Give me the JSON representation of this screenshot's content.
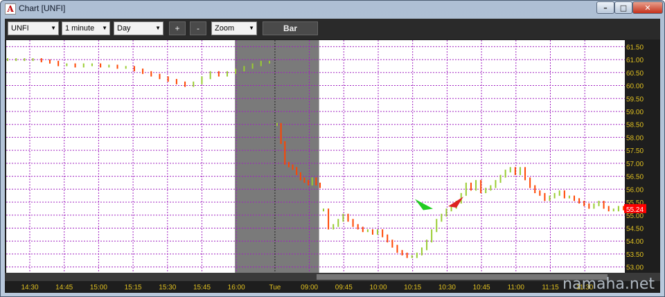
{
  "window": {
    "title": "Chart [UNFI]",
    "app_icon_letter": "A",
    "min_glyph": "–",
    "max_glyph": "□",
    "close_glyph": "✕"
  },
  "toolbar": {
    "symbol": "UNFI",
    "interval": "1 minute",
    "period": "Day",
    "zoom_in_label": "+",
    "zoom_out_label": "-",
    "zoom": "Zoom",
    "style_button": "Bar"
  },
  "watermark": "namaha.net",
  "chart_data": {
    "type": "bar",
    "price_axis": {
      "ticks": [
        "61.50",
        "61.00",
        "60.50",
        "60.00",
        "59.50",
        "59.00",
        "58.50",
        "58.00",
        "57.50",
        "57.00",
        "56.50",
        "56.00",
        "55.50",
        "55.00",
        "54.50",
        "54.00",
        "53.50",
        "53.00"
      ],
      "ylim": [
        52.75,
        61.75
      ]
    },
    "time_axis": {
      "ticks": [
        "14:30",
        "14:45",
        "15:00",
        "15:15",
        "15:30",
        "15:45",
        "16:00",
        "Tue",
        "09:00",
        "09:45",
        "10:00",
        "10:15",
        "10:30",
        "10:45",
        "11:00",
        "11:15",
        "11:30"
      ],
      "shaded_session": [
        "16:00",
        "09:00"
      ]
    },
    "last_price": "55.24",
    "series": [
      {
        "segment": "prev-day-afternoon",
        "values": [
          61.0,
          61.0,
          61.0,
          61.0,
          60.95,
          60.9,
          60.8,
          60.8,
          60.75,
          60.8,
          60.8,
          60.75,
          60.75,
          60.7,
          60.7,
          60.6,
          60.5,
          60.4,
          60.3,
          60.2,
          60.1,
          60.0,
          60.1,
          60.3,
          60.5,
          60.4,
          60.5,
          60.6,
          60.7,
          60.8,
          60.9,
          60.9
        ]
      },
      {
        "segment": "pre-market",
        "values": [
          58.5,
          57.8,
          57.0,
          56.9,
          56.8,
          56.6,
          56.4,
          56.3,
          56.2,
          56.4,
          56.2,
          56.1
        ]
      },
      {
        "segment": "regular-session",
        "values": [
          55.2,
          54.5,
          54.6,
          54.8,
          55.0,
          54.8,
          54.6,
          54.5,
          54.4,
          54.4,
          54.3,
          54.4,
          54.2,
          54.0,
          53.8,
          53.6,
          53.5,
          53.4,
          53.4,
          53.5,
          53.7,
          54.0,
          54.4,
          54.8,
          55.0,
          55.2,
          55.3,
          55.5,
          55.8,
          56.2,
          56.0,
          56.3,
          55.9,
          56.0,
          56.1,
          56.3,
          56.5,
          56.7,
          56.8,
          56.6,
          56.8,
          56.4,
          56.1,
          55.9,
          55.8,
          55.6,
          55.7,
          55.8,
          55.9,
          55.7,
          55.7,
          55.6,
          55.5,
          55.4,
          55.3,
          55.4,
          55.5,
          55.3,
          55.2,
          55.2,
          55.3,
          55.24
        ]
      }
    ],
    "markers": [
      {
        "type": "buy-arrow",
        "color": "#22cc22",
        "price": 55.3
      },
      {
        "type": "sell-arrow",
        "color": "#dd2222",
        "price": 55.5
      }
    ],
    "colors": {
      "up": "#9acd32",
      "down": "#ff4500",
      "grid": "#a020c0",
      "shade": "#7a7a7a",
      "last_price_bg": "#ff0000"
    }
  }
}
